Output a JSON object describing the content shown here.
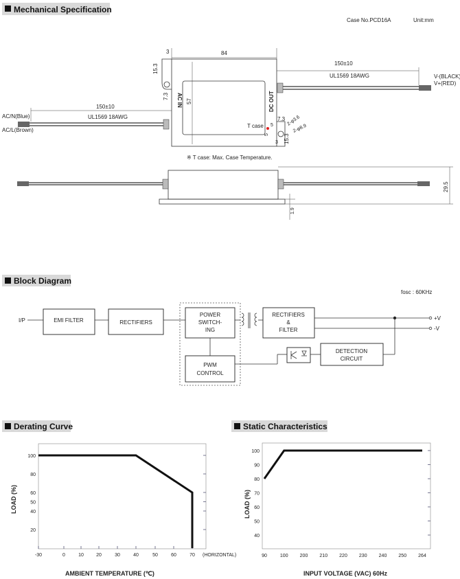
{
  "mechanical": {
    "title": "Mechanical Specification",
    "case_no": "Case No.PCD16A",
    "unit": "Unit:mm",
    "dim_width": "84",
    "dim_tab": "3",
    "dim_height": "57",
    "dim_hole_offset_top": "15.3",
    "dim_hole_inset": "7.3",
    "dim_out_inset": "7.3",
    "dim_hole_offset_bottom": "15.3",
    "dim_tcase_h": "5",
    "dim_tcase_v": "5",
    "dim_tab_bottom": "3",
    "hole_small": "2-φ3.6",
    "hole_large": "2-φ8.9",
    "out_length": "150±10",
    "out_wire": "UL1569 18AWG",
    "out_neg": "V-(BLACK)",
    "out_pos": "V+(RED)",
    "in_length": "150±10",
    "in_wire": "UL1569 18AWG",
    "in_n": "AC/N(Blue)",
    "in_l": "AC/L(Brown)",
    "ac_in": "AC IN",
    "dc_out": "DC OUT",
    "tcase": "T case",
    "tcase_color": "#e02020",
    "note": "※ T case: Max. Case Temperature.",
    "side_height": "29.5",
    "side_foot": "1.9"
  },
  "block": {
    "title": "Block Diagram",
    "fosc": "fosc : 60KHz",
    "ip": "I/P",
    "emi": "EMI FILTER",
    "rect1": "RECTIFIERS",
    "psw": [
      "POWER",
      "SWITCH-",
      "ING"
    ],
    "pwm": [
      "PWM",
      "CONTROL"
    ],
    "rect2": [
      "RECTIFIERS",
      "&",
      "FILTER"
    ],
    "detect": [
      "DETECTION",
      "CIRCUIT"
    ],
    "vplus": "+V",
    "vminus": "-V"
  },
  "chart_data": [
    {
      "type": "line",
      "title": "Derating Curve",
      "xlabel": "AMBIENT TEMPERATURE (℃)",
      "ylabel": "LOAD (%)",
      "x_ticks": [
        "-30",
        "0",
        "10",
        "20",
        "30",
        "40",
        "50",
        "60",
        "70"
      ],
      "x_extra_label": "(HORIZONTAL)",
      "y_ticks": [
        "20",
        "40",
        "50",
        "60",
        "80",
        "100"
      ],
      "xlim": [
        -30,
        75
      ],
      "ylim": [
        0,
        110
      ],
      "grid": false,
      "series": [
        {
          "x": [
            -30,
            40,
            70,
            70
          ],
          "y": [
            100,
            100,
            60,
            0
          ]
        }
      ]
    },
    {
      "type": "line",
      "title": "Static Characteristics",
      "xlabel": "INPUT VOLTAGE (VAC) 60Hz",
      "ylabel": "LOAD (%)",
      "x_ticks": [
        "90",
        "100",
        "200",
        "210",
        "220",
        "230",
        "240",
        "250",
        "264"
      ],
      "y_ticks": [
        "40",
        "50",
        "60",
        "70",
        "80",
        "90",
        "100"
      ],
      "ylim": [
        35,
        105
      ],
      "grid": false,
      "series": [
        {
          "x": [
            90,
            100,
            264
          ],
          "y": [
            80,
            100,
            100
          ]
        }
      ]
    }
  ]
}
